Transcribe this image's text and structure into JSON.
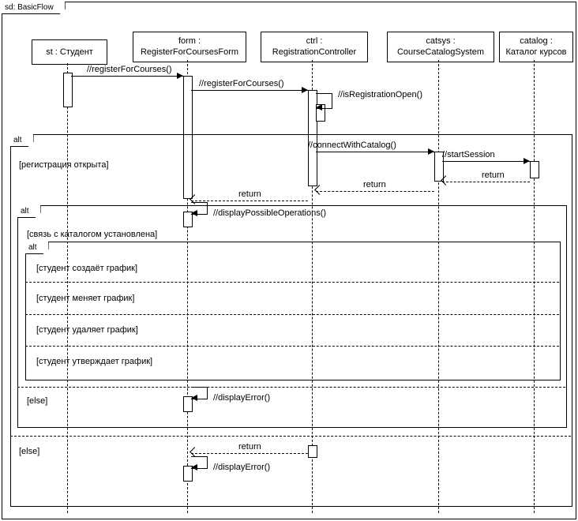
{
  "diagram": {
    "title": "sd: BasicFlow",
    "lifelines": {
      "student": "st : Студент",
      "form_l1": "form :",
      "form_l2": "RegisterForCoursesForm",
      "ctrl_l1": "ctrl :",
      "ctrl_l2": "RegistrationController",
      "catsys_l1": "catsys :",
      "catsys_l2": "CourseCatalogSystem",
      "catalog_l1": "catalog :",
      "catalog_l2": "Каталог курсов"
    },
    "messages": {
      "m1": "//registerForCourses()",
      "m2": "//registerForCourses()",
      "m3": "//isRegistrationOpen()",
      "m4": "//connectWithCatalog()",
      "m5": "//startSession",
      "ret": "return",
      "m6": "//displayPossibleOperations()",
      "m7": "//displayError()",
      "m8": "//displayError()"
    },
    "fragments": {
      "alt": "alt"
    },
    "guards": {
      "g1": "[регистрация открыта]",
      "g2": "[связь с каталогом установлена]",
      "g3": "[студент создаёт график]",
      "g4": "[студент меняет график]",
      "g5": "[студент удаляет график]",
      "g6": "[студент утверждает график]",
      "g_else": "[else]"
    }
  }
}
